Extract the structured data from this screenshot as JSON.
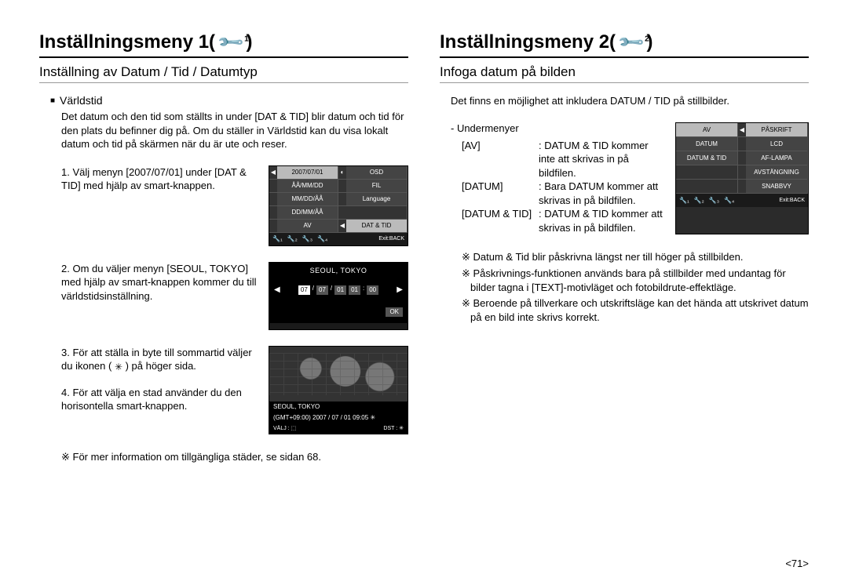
{
  "left": {
    "heading": "Inställningsmeny 1(",
    "heading_close": ")",
    "icon_sub": "1",
    "subtitle": "Inställning av Datum / Tid / Datumtyp",
    "bullet_title": "Världstid",
    "intro": "Det datum och den tid som ställts in under [DAT & TID] blir datum och tid för den plats du befinner dig på. Om du ställer in Världstid kan du visa lokalt datum och tid på skärmen när du är ute och reser.",
    "step1": "1. Välj menyn [2007/07/01] under [DAT & TID] med hjälp av smart-knappen.",
    "step2": "2. Om du väljer menyn [SEOUL, TOKYO] med hjälp av smart-knappen kommer du till världstidsinställning.",
    "step3_a": "3. För att ställa in byte till sommartid väljer du ikonen (",
    "step3_b": ") på höger sida.",
    "step4": "4. För att välja en stad använder du den horisontella smart-knappen.",
    "note": "※ För mer information om tillgängliga städer, se sidan 68.",
    "cam1": {
      "r1l": "2007/07/01",
      "r1r": "OSD",
      "r2l": "ÅÅ/MM/DD",
      "r2r": "FIL",
      "r3l": "MM/DD/ÅÅ",
      "r3r": "Language",
      "r4l": "DD/MM/ÅÅ",
      "r5l": "AV",
      "r5r": "DAT & TID",
      "exit": "Exit:BACK"
    },
    "cam2": {
      "city": "SEOUL, TOKYO",
      "d1": "07",
      "d2": "07",
      "d3": "01",
      "d4": "01",
      "d5": "00",
      "ok": "OK"
    },
    "cam3": {
      "city": "SEOUL, TOKYO",
      "gmt": "(GMT+09:00) 2007 / 07 / 01 09:05",
      "valj": "VÄLJ :",
      "dst": "DST :"
    }
  },
  "right": {
    "heading": "Inställningsmeny 2(",
    "heading_close": ")",
    "icon_sub": "2",
    "subtitle": "Infoga datum på bilden",
    "intro": "Det finns en möjlighet att inkludera DATUM / TID på stillbilder.",
    "submenu_label": "- Undermenyer",
    "defs": {
      "k1": "[AV]",
      "v1": ": DATUM & TID kommer inte att skrivas in på bildfilen.",
      "k2": "[DATUM]",
      "v2": ": Bara DATUM kommer att skrivas in på bildfilen.",
      "k3": "[DATUM & TID]",
      "v3": ": DATUM & TID kommer att skrivas in på bildfilen."
    },
    "notes": {
      "n1": "※ Datum & Tid blir påskrivna längst ner till höger på stillbilden.",
      "n2": "※ Påskrivnings-funktionen används bara på stillbilder med undantag för bilder tagna i [TEXT]-motivläget och fotobildrute-effektläge.",
      "n3": "※ Beroende på tillverkare och utskriftsläge kan det hända att utskrivet datum på en bild inte skrivs korrekt."
    },
    "cam": {
      "r1l": "AV",
      "r1r": "PÅSKRIFT",
      "r2l": "DATUM",
      "r2r": "LCD",
      "r3l": "DATUM & TID",
      "r3r": "AF-LAMPA",
      "r4r": "AVSTÄNGNING",
      "r5r": "SNABBVY",
      "exit": "Exit:BACK"
    }
  },
  "pagenum": "<71>"
}
